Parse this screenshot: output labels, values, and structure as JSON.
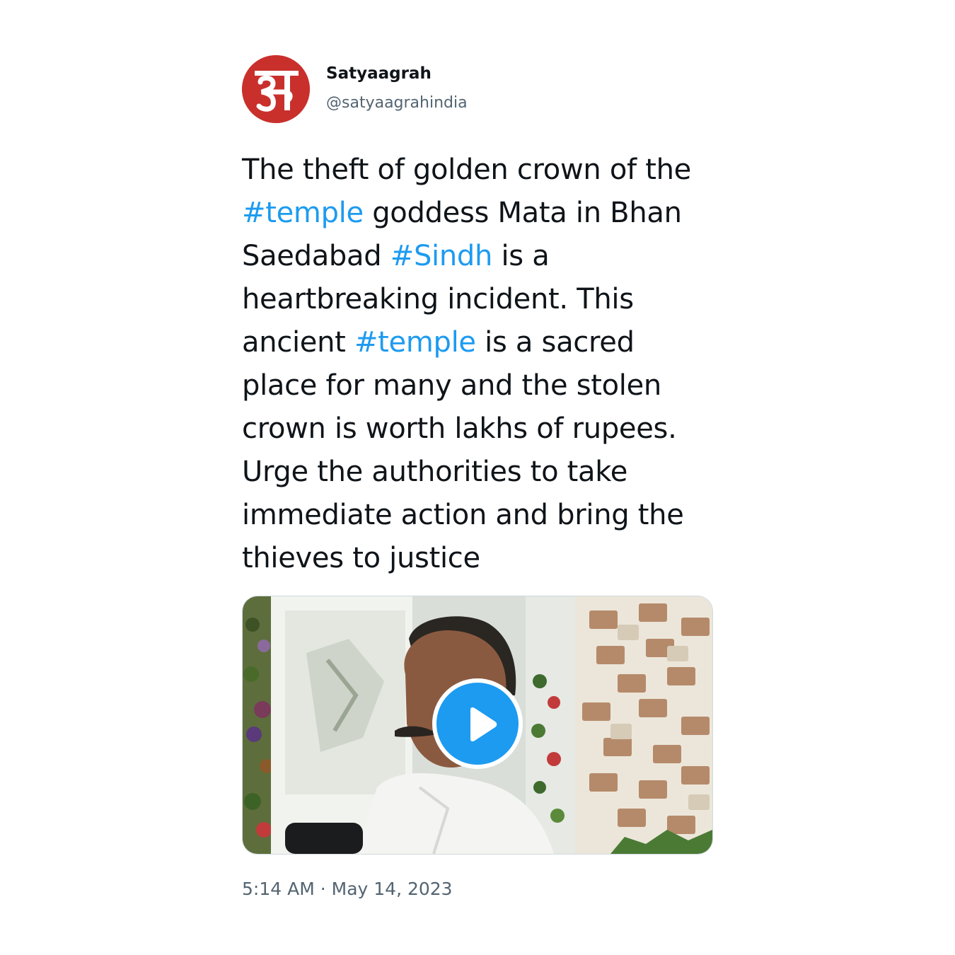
{
  "author": {
    "display_name": "Satyaagrah",
    "handle": "@satyaagrahindia",
    "avatar": {
      "icon": "satyaagrah-logo-icon",
      "glyph": "स",
      "background": "#c9302c"
    }
  },
  "tweet": {
    "segments": [
      {
        "text": "The theft of golden crown of the ",
        "type": "text"
      },
      {
        "text": "#temple",
        "type": "hashtag"
      },
      {
        "text": " goddess Mata in Bhan Saedabad ",
        "type": "text"
      },
      {
        "text": "#Sindh",
        "type": "hashtag"
      },
      {
        "text": " is a heartbreaking incident. This ancient ",
        "type": "text"
      },
      {
        "text": "#temple",
        "type": "hashtag"
      },
      {
        "text": " is a sacred place for many and the stolen crown is worth lakhs of rupees. Urge the authorities to take immediate action and bring the thieves to justice",
        "type": "text"
      }
    ]
  },
  "media": {
    "type": "video",
    "play_icon": "play-icon"
  },
  "meta": {
    "time": "5:14 AM",
    "separator": "·",
    "date": "May 14, 2023"
  },
  "colors": {
    "hashtag": "#1d9bf0",
    "text": "#0f1419",
    "secondary": "#536471",
    "border": "#cfd9de"
  }
}
